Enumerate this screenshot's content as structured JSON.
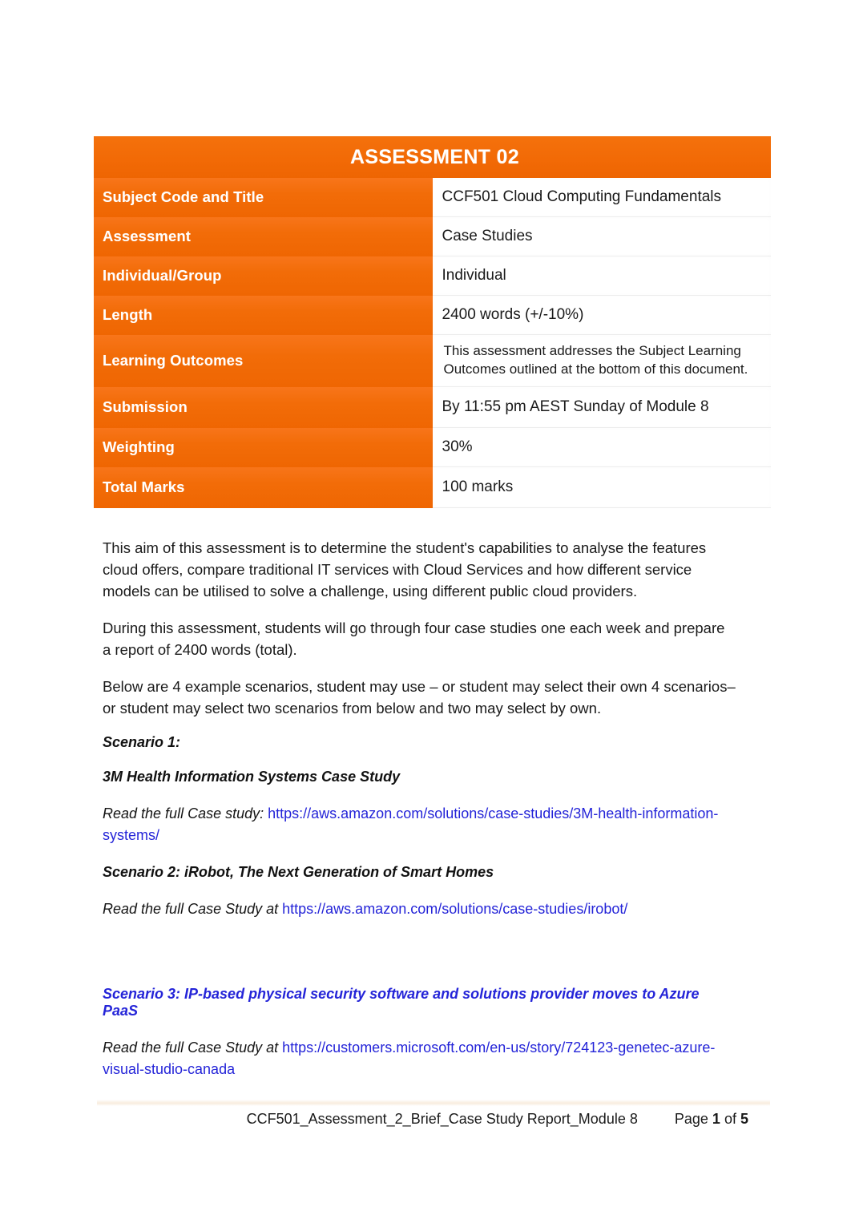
{
  "table": {
    "title": "ASSESSMENT 02",
    "rows": [
      {
        "label": "Subject Code and Title",
        "value": "CCF501 Cloud Computing Fundamentals",
        "two_line": false
      },
      {
        "label": "Assessment",
        "value": "Case Studies",
        "two_line": false
      },
      {
        "label": "Individual/Group",
        "value": "Individual",
        "two_line": false
      },
      {
        "label": "Length",
        "value": "2400 words (+/-10%)",
        "two_line": false
      },
      {
        "label": "Learning Outcomes",
        "value": "This assessment addresses the Subject Learning Outcomes outlined at the bottom of this document.",
        "two_line": true
      },
      {
        "label": "Submission",
        "value": "By 11:55 pm AEST Sunday of Module 8",
        "two_line": false
      },
      {
        "label": "Weighting",
        "value": "30%",
        "two_line": false
      },
      {
        "label": "Total Marks",
        "value": "100 marks",
        "two_line": false
      }
    ]
  },
  "body": {
    "p1": "This aim of this assessment is to determine the student's capabilities to analyse the features cloud offers, compare traditional IT services with Cloud Services and how different service models can be utilised to solve a challenge, using different public cloud providers.",
    "p2": "During this assessment, students will go through four case studies one each week and prepare a report of 2400 words (total).",
    "p3": "Below are 4 example scenarios, student may use – or student may select their own 4 scenarios– or student may select two scenarios from below and two may select by own."
  },
  "scenarios": {
    "s1_label": "Scenario 1:",
    "s1_title": "3M Health Information Systems Case Study",
    "s1_read_prefix": "Read the full Case study: ",
    "s1_url": "https://aws.amazon.com/solutions/case-studies/3M-health-information-systems/",
    "s2_title": "Scenario 2: iRobot, The Next Generation of Smart Homes",
    "s2_read_prefix": "Read the full Case Study at ",
    "s2_url": "https://aws.amazon.com/solutions/case-studies/irobot/",
    "s3_title": "Scenario 3: IP-based physical security software and solutions provider moves to Azure PaaS",
    "s3_read_prefix": "Read the full Case Study at ",
    "s3_url": "https://customers.microsoft.com/en-us/story/724123-genetec-azure-visual-studio-canada"
  },
  "footer": {
    "doc_ref": "CCF501_Assessment_2_Brief_Case Study Report_Module 8",
    "page_label": "Page",
    "page_number": "1",
    "of_label": "of",
    "page_total": "5"
  },
  "colors": {
    "orange": "#f26c08",
    "orange_light": "#f8751a",
    "link_blue": "#2424d8",
    "text": "#1a1a1a",
    "row_divider": "#ececec"
  }
}
